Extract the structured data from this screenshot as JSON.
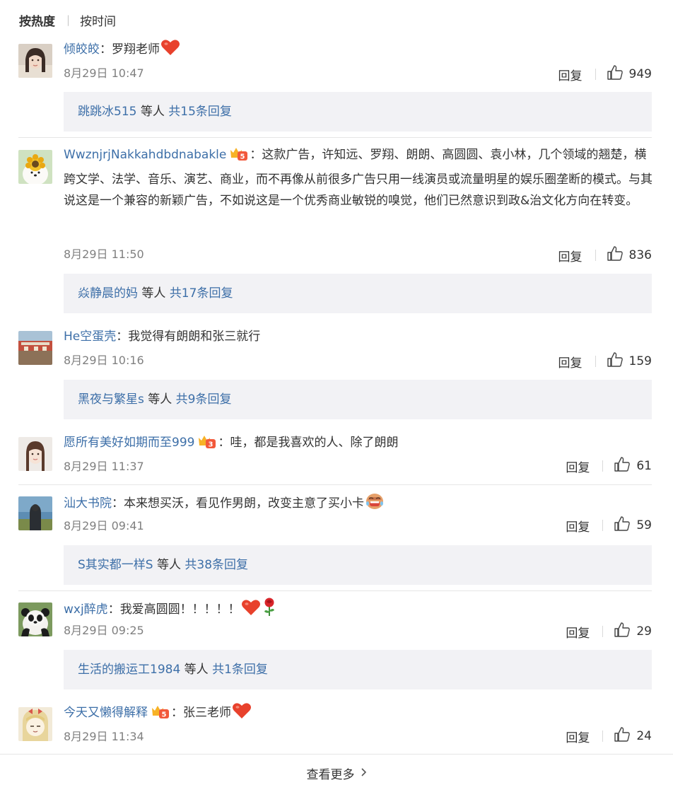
{
  "sort": {
    "hot": "按热度",
    "time": "按时间"
  },
  "comments": [
    {
      "user": "倾皎皎",
      "text": "罗翔老师",
      "emoji": "heart-emoji",
      "date": "8月29日 10:47",
      "reply": "回复",
      "likes": "949",
      "reply_box": {
        "user": "跳跳冰515",
        "middle": " 等人 ",
        "total": "共15条回复"
      }
    },
    {
      "user": "WwznjrjNakkahdbdnabakle",
      "vip": "vip-5-badge",
      "text": "这款广告，许知远、罗翔、朗朗、高圆圆、袁小林，几个领域的翘楚，横跨文学、法学、音乐、演艺、商业，而不再像从前很多广告只用一线演员或流量明星的娱乐圈垄断的模式。与其说这是一个兼容的新颖广告，不如说这是一个优秀商业敏锐的嗅觉，他们已然意识到政&治文化方向在转变。",
      "date": "8月29日 11:50",
      "reply": "回复",
      "likes": "836",
      "reply_box": {
        "user": "焱静晨的妈",
        "middle": " 等人 ",
        "total": "共17条回复"
      }
    },
    {
      "user": "He空蛋壳",
      "text": "我觉得有朗朗和张三就行",
      "date": "8月29日 10:16",
      "reply": "回复",
      "likes": "159",
      "reply_box": {
        "user": "黑夜与繁星s",
        "middle": " 等人 ",
        "total": "共9条回复"
      }
    },
    {
      "user": "愿所有美好如期而至999",
      "vip": "vip-3-badge",
      "text": "哇，都是我喜欢的人、除了朗朗",
      "date": "8月29日 11:37",
      "reply": "回复",
      "likes": "61"
    },
    {
      "user": "汕大书院",
      "text": "本来想买沃，看见作男朗，改变主意了买小卡",
      "emoji": "crying-laugh-emoji",
      "date": "8月29日 09:41",
      "reply": "回复",
      "likes": "59",
      "reply_box": {
        "user": "S其实都一样S",
        "middle": " 等人 ",
        "total": "共38条回复"
      }
    },
    {
      "user": "wxj醉虎",
      "text": "我爱高圆圆！！！！！",
      "emoji": "heart-rose-emoji",
      "date": "8月29日 09:25",
      "reply": "回复",
      "likes": "29",
      "reply_box": {
        "user": "生活的搬运工1984",
        "middle": " 等人 ",
        "total": "共1条回复"
      }
    },
    {
      "user": "今天又懒得解释",
      "vip": "vip-5-badge",
      "text": "张三老师",
      "emoji": "heart-emoji",
      "date": "8月29日 11:34",
      "reply": "回复",
      "likes": "24"
    }
  ],
  "colon": "：",
  "more": "查看更多",
  "colors": {
    "username": "#3d6fa8",
    "reply_bg": "#f2f2f5",
    "date": "#808080",
    "heart": "#e8412c"
  }
}
